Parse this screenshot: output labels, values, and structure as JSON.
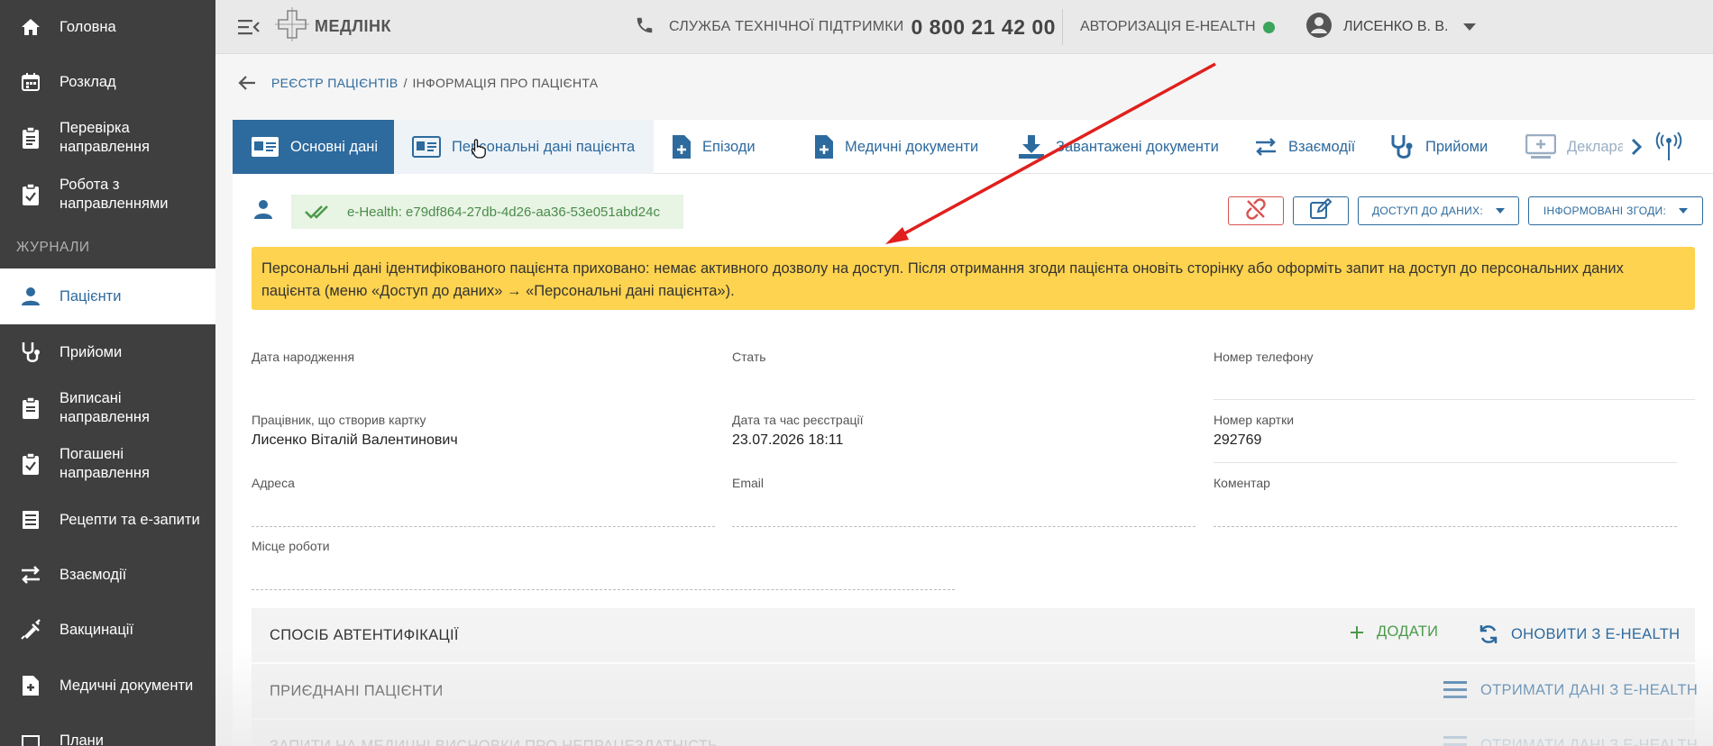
{
  "sidebar": {
    "items_top": [
      {
        "label": "Головна",
        "icon": "home-icon"
      },
      {
        "label": "Розклад",
        "icon": "calendar-icon"
      },
      {
        "label": "Перевірка направлення",
        "icon": "clipboard-icon"
      },
      {
        "label": "Робота з направленнями",
        "icon": "clipboard-check-icon"
      }
    ],
    "section_label": "ЖУРНАЛИ",
    "items_journal": [
      {
        "label": "Пацієнти",
        "icon": "person-icon",
        "active": true
      },
      {
        "label": "Прийоми",
        "icon": "stethoscope-icon"
      },
      {
        "label": "Виписані направлення",
        "icon": "clipboard-icon"
      },
      {
        "label": "Погашені направлення",
        "icon": "clipboard-check-icon"
      },
      {
        "label": "Рецепти та е-запити",
        "icon": "list-icon"
      },
      {
        "label": "Взаємодії",
        "icon": "swap-icon"
      },
      {
        "label": "Вакцинації",
        "icon": "syringe-icon"
      },
      {
        "label": "Медичні документи",
        "icon": "document-plus-icon"
      },
      {
        "label": "Плани",
        "icon": "plan-icon"
      }
    ]
  },
  "topbar": {
    "logo_text": "МЕДЛІНК",
    "support_label": "СЛУЖБА ТЕХНІЧНОЇ ПІДТРИМКИ",
    "support_phone": "0 800 21 42 00",
    "ehealth_auth": "АВТОРИЗАЦІЯ E-HEALTH",
    "ehealth_status_color": "#3ba55c",
    "user_name": "ЛИСЕНКО В. В."
  },
  "breadcrumb": {
    "link": "РЕЄСТР ПАЦІЄНТІВ",
    "separator": "/",
    "current": "ІНФОРМАЦІЯ ПРО ПАЦІЄНТА"
  },
  "tabs": [
    {
      "label": "Основні дані",
      "icon": "id-card-icon",
      "state": "active"
    },
    {
      "label": "Персональні дані пацієнта",
      "icon": "id-card-icon",
      "state": "hover"
    },
    {
      "label": "Епізоди",
      "icon": "document-plus-icon",
      "state": ""
    },
    {
      "label": "Медичні документи",
      "icon": "document-plus-icon",
      "state": ""
    },
    {
      "label": "Завантажені документи",
      "icon": "download-icon",
      "state": ""
    },
    {
      "label": "Взаємодії",
      "icon": "swap-icon",
      "state": ""
    },
    {
      "label": "Прийоми",
      "icon": "stethoscope-icon",
      "state": ""
    },
    {
      "label": "Декларації",
      "icon": "monitor-plus-icon",
      "state": "faded"
    }
  ],
  "patient": {
    "ehealth_id": "e-Health: e79df864-27db-4d26-aa36-53e051abd24c",
    "access_dropdown": "ДОСТУП ДО ДАНИХ:",
    "consents_dropdown": "ІНФОРМОВАНІ ЗГОДИ:"
  },
  "warning_text": "Персональні дані ідентифікованого пацієнта приховано: немає активного дозволу на доступ. Після отримання згоди пацієнта оновіть сторінку або оформіть запит на доступ до персональних даних пацієнта (меню «Доступ до даних» → «Персональні дані пацієнта»).",
  "fields": {
    "birth_date": {
      "label": "Дата народження",
      "value": ""
    },
    "gender": {
      "label": "Стать",
      "value": ""
    },
    "phone": {
      "label": "Номер телефону",
      "value": ""
    },
    "creator": {
      "label": "Працівник, що створив картку",
      "value": "Лисенко Віталій Валентинович"
    },
    "reg_datetime": {
      "label": "Дата та час реєстрації",
      "value": "23.07.2026 18:11"
    },
    "card_number": {
      "label": "Номер картки",
      "value": "292769"
    },
    "address": {
      "label": "Адреса",
      "value": ""
    },
    "email": {
      "label": "Email",
      "value": ""
    },
    "comment": {
      "label": "Коментар",
      "value": ""
    },
    "workplace": {
      "label": "Місце роботи",
      "value": ""
    }
  },
  "sections": {
    "auth_method": {
      "title": "СПОСІБ АВТЕНТИФІКАЦІЇ",
      "add": "ДОДАТИ",
      "refresh": "ОНОВИТИ З E-HEALTH"
    },
    "linked_patients": {
      "title": "ПРИЄДНАНІ ПАЦІЄНТИ",
      "fetch": "ОТРИМАТИ ДАНІ З E-HEALTH"
    },
    "sick_leave": {
      "title": "ЗАПИТИ НА МЕДИЧНІ ВИСНОВКИ ПРО НЕПРАЦЕЗДАТНІСТЬ",
      "fetch": "ОТРИМАТИ ДАНІ З E-HEALTH"
    }
  },
  "colors": {
    "brand_blue": "#2d6a9e",
    "sidebar_bg": "#3f3f3f",
    "warning_bg": "#fdd34f",
    "success_green": "#4a9a4a",
    "annotation_red": "#e0201e"
  }
}
